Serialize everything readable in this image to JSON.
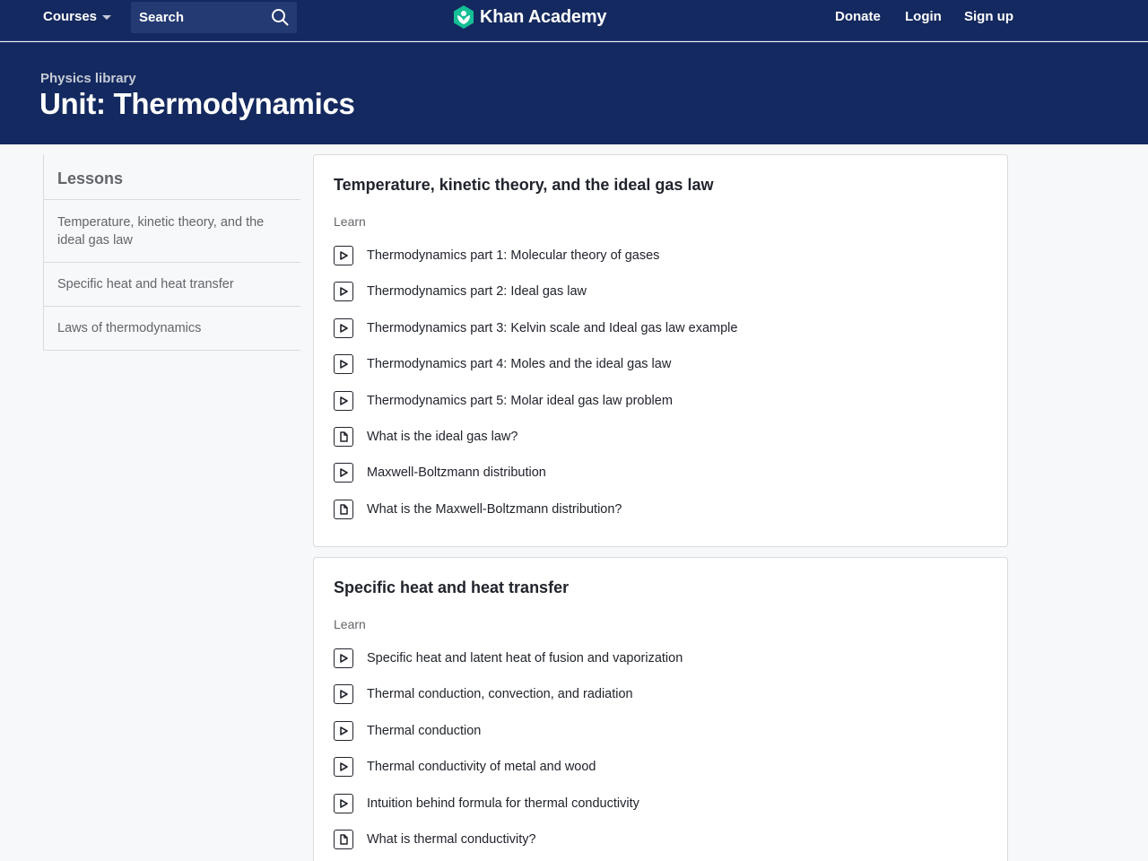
{
  "nav": {
    "courses_label": "Courses",
    "search_label": "Search",
    "logo_text": "Khan Academy",
    "donate_label": "Donate",
    "login_label": "Login",
    "signup_label": "Sign up"
  },
  "header": {
    "breadcrumb": "Physics library",
    "title": "Unit: Thermodynamics"
  },
  "sidebar": {
    "heading": "Lessons",
    "items": [
      {
        "label": "Temperature, kinetic theory, and the ideal gas law"
      },
      {
        "label": "Specific heat and heat transfer"
      },
      {
        "label": "Laws of thermodynamics"
      }
    ]
  },
  "lessons": [
    {
      "title": "Temperature, kinetic theory, and the ideal gas law",
      "section": "Learn",
      "items": [
        {
          "label": "Thermodynamics part 1: Molecular theory of gases",
          "icon": "play-icon"
        },
        {
          "label": "Thermodynamics part 2: Ideal gas law",
          "icon": "play-icon"
        },
        {
          "label": "Thermodynamics part 3: Kelvin scale and Ideal gas law example",
          "icon": "play-icon"
        },
        {
          "label": "Thermodynamics part 4: Moles and the ideal gas law",
          "icon": "play-icon"
        },
        {
          "label": "Thermodynamics part 5: Molar ideal gas law problem",
          "icon": "play-icon"
        },
        {
          "label": "What is the ideal gas law?",
          "icon": "article-icon"
        },
        {
          "label": "Maxwell-Boltzmann distribution",
          "icon": "play-icon"
        },
        {
          "label": "What is the Maxwell-Boltzmann distribution?",
          "icon": "article-icon"
        }
      ]
    },
    {
      "title": "Specific heat and heat transfer",
      "section": "Learn",
      "items": [
        {
          "label": "Specific heat and latent heat of fusion and vaporization",
          "icon": "play-icon"
        },
        {
          "label": "Thermal conduction, convection, and radiation",
          "icon": "play-icon"
        },
        {
          "label": "Thermal conduction",
          "icon": "play-icon"
        },
        {
          "label": "Thermal conductivity of metal and wood",
          "icon": "play-icon"
        },
        {
          "label": "Intuition behind formula for thermal conductivity",
          "icon": "play-icon"
        },
        {
          "label": "What is thermal conductivity?",
          "icon": "article-icon"
        }
      ]
    }
  ],
  "colors": {
    "brand_navy": "#14295f",
    "text": "#21242c",
    "muted": "#626569",
    "logo_green": "#14bf96"
  }
}
